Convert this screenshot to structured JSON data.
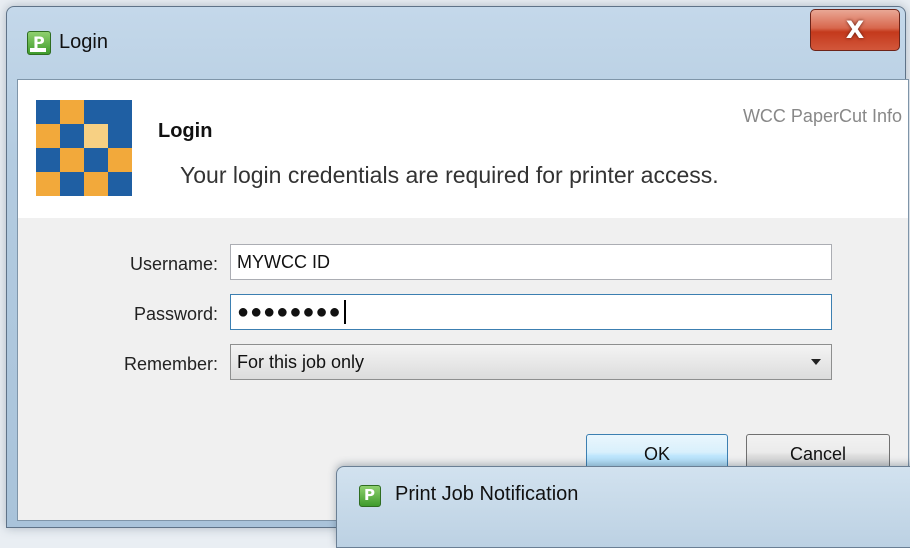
{
  "window": {
    "title": "Login",
    "close_glyph": "X",
    "app_icon_glyph": "P"
  },
  "header": {
    "title": "Login",
    "description": "Your login credentials are required for printer access.",
    "link": "WCC PaperCut Info"
  },
  "form": {
    "username_label": "Username:",
    "username_value": "MYWCC ID",
    "password_label": "Password:",
    "password_value": "●●●●●●●●",
    "remember_label": "Remember:",
    "remember_value": "For this job only"
  },
  "buttons": {
    "ok": "OK",
    "cancel": "Cancel"
  },
  "notification": {
    "title": "Print Job Notification",
    "app_icon_glyph": "P"
  },
  "icons": {
    "app": "papercut-icon",
    "close": "close-icon",
    "dropdown": "chevron-down-icon",
    "logo": "papercut-logo"
  },
  "colors": {
    "logo_blue": "#1f5fa3",
    "logo_orange": "#f2a93b",
    "logo_light": "#f7d083",
    "close_red": "#c4391c"
  }
}
